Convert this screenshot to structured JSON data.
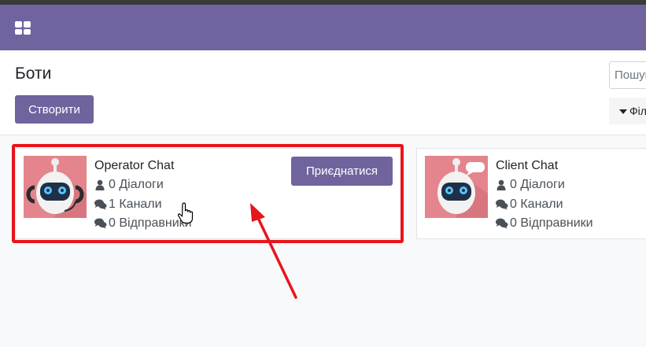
{
  "navbar": {
    "apps_icon": "apps-grid-icon"
  },
  "control_panel": {
    "title": "Боти",
    "create_label": "Створити",
    "search_placeholder": "Пошук...",
    "filters_label": "Фільтри"
  },
  "cards": [
    {
      "name": "Operator Chat",
      "join_label": "Приєднатися",
      "dialogs": "0 Діалоги",
      "channels": "1 Канали",
      "senders": "0 Відправники"
    },
    {
      "name": "Client Chat",
      "dialogs": "0 Діалоги",
      "channels": "0 Канали",
      "senders": "0 Відправники"
    }
  ],
  "annotation": {
    "color": "#e8141c"
  },
  "colors": {
    "brand": "#71639e",
    "avatar_bg": "#e4858d"
  }
}
